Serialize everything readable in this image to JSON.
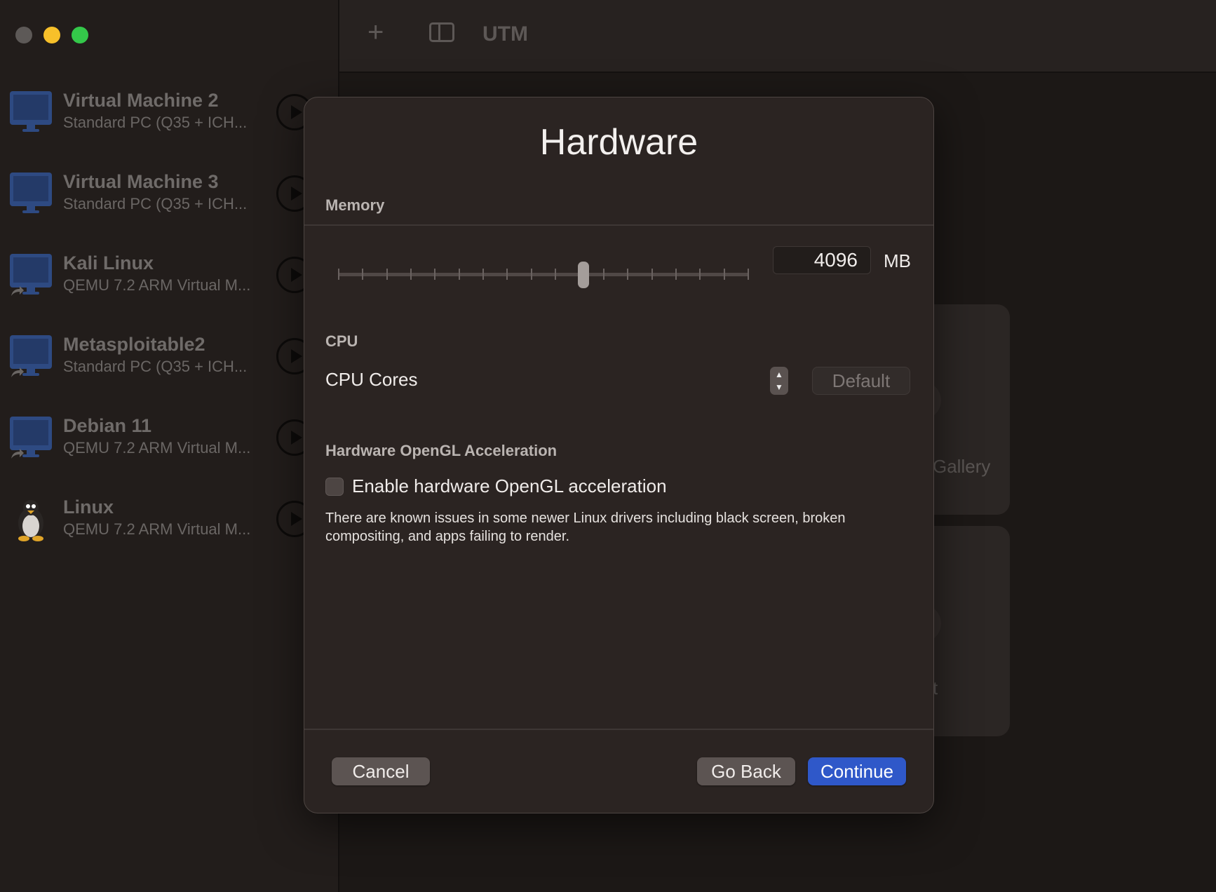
{
  "window": {
    "title": "UTM",
    "traffic_colors": [
      "#5d5957",
      "#f7c02a",
      "#34c84a"
    ]
  },
  "sidebar": {
    "vms": [
      {
        "name": "Virtual Machine 2",
        "subtitle": "Standard PC (Q35 + ICH...",
        "icon": "monitor-icon",
        "shared": false
      },
      {
        "name": "Virtual Machine 3",
        "subtitle": "Standard PC (Q35 + ICH...",
        "icon": "monitor-icon",
        "shared": false
      },
      {
        "name": "Kali Linux",
        "subtitle": "QEMU 7.2 ARM Virtual M...",
        "icon": "monitor-icon",
        "shared": true
      },
      {
        "name": "Metasploitable2",
        "subtitle": "Standard PC (Q35 + ICH...",
        "icon": "monitor-icon",
        "shared": true
      },
      {
        "name": "Debian 11",
        "subtitle": "QEMU 7.2 ARM Virtual M...",
        "icon": "monitor-icon",
        "shared": true
      },
      {
        "name": "Linux",
        "subtitle": "QEMU 7.2 ARM Virtual M...",
        "icon": "penguin-icon",
        "shared": false
      }
    ]
  },
  "background": {
    "gallery_text": "Gallery",
    "card2_text": "t"
  },
  "dialog": {
    "title": "Hardware",
    "memory": {
      "section": "Memory",
      "value": "4096",
      "unit": "MB",
      "slider_fraction": 0.6
    },
    "cpu": {
      "section": "CPU",
      "cores_label": "CPU Cores",
      "cores_placeholder": "Default"
    },
    "opengl": {
      "section": "Hardware OpenGL Acceleration",
      "checkbox_label": "Enable hardware OpenGL acceleration",
      "checked": false,
      "note": "There are known issues in some newer Linux drivers including black screen, broken compositing, and apps failing to render."
    },
    "buttons": {
      "cancel": "Cancel",
      "go_back": "Go Back",
      "continue": "Continue"
    }
  },
  "colors": {
    "accent": "#2f58c9",
    "monitor": "#2e4a82"
  }
}
